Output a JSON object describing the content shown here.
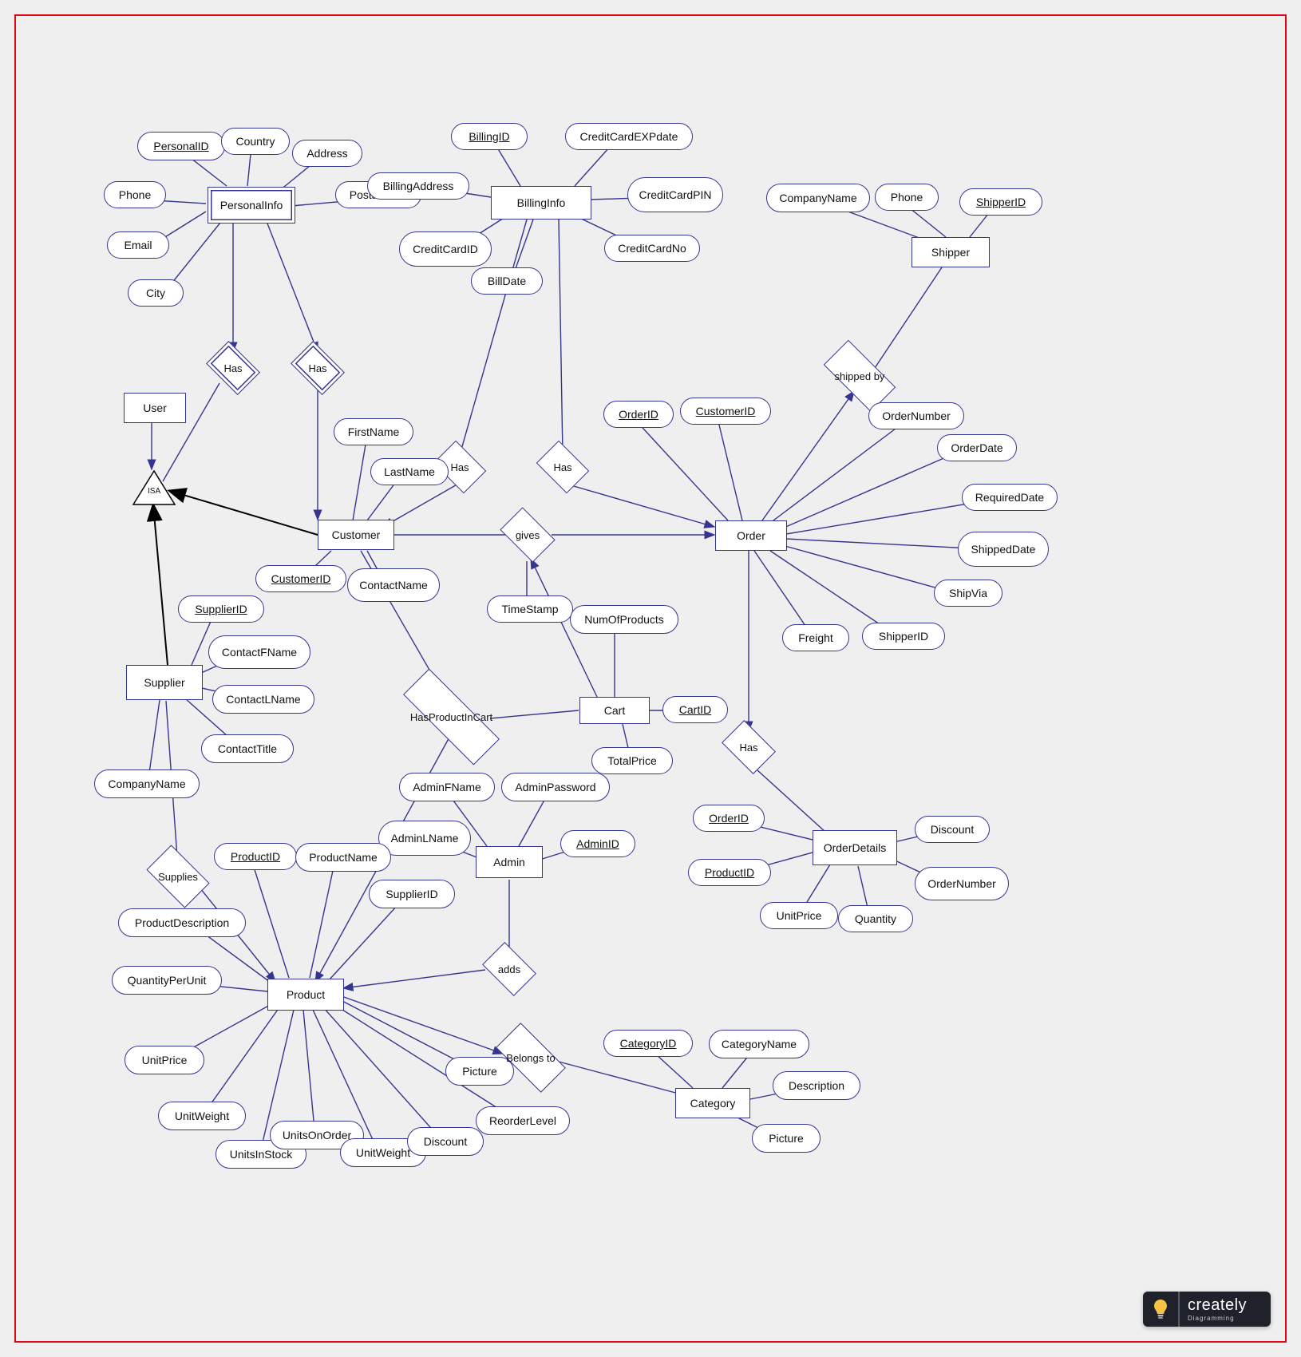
{
  "badge": {
    "title": "creately",
    "subtitle": "Diagramming"
  },
  "entities": {
    "personalInfo": "PersonalInfo",
    "user": "User",
    "billingInfo": "BillingInfo",
    "shipper": "Shipper",
    "customer": "Customer",
    "order": "Order",
    "supplier": "Supplier",
    "cart": "Cart",
    "admin": "Admin",
    "orderDetails": "OrderDetails",
    "product": "Product",
    "category": "Category"
  },
  "relationships": {
    "has1": "Has",
    "has2": "Has",
    "hasBillingC": "Has",
    "hasBillingO": "Has",
    "shippedBy": "shipped by",
    "gives": "gives",
    "hasProductInCart": "HasProductInCart",
    "orderHasDetails": "Has",
    "supplies": "Supplies",
    "adds": "adds",
    "belongsTo": "Belongs to"
  },
  "isa": "ISA",
  "attributes": {
    "personalInfo": {
      "personalID": "PersonalID",
      "country": "Country",
      "address": "Address",
      "postalCode": "PostalCode",
      "phone": "Phone",
      "email": "Email",
      "city": "City"
    },
    "billingInfo": {
      "billingID": "BillingID",
      "creditCardEXPdate": "CreditCardEXPdate",
      "billingAddress": "BillingAddress",
      "creditCardPIN": "CreditCardPIN",
      "creditCardID": "CreditCardID",
      "creditCardNo": "CreditCardNo",
      "billDate": "BillDate"
    },
    "shipper": {
      "companyName": "CompanyName",
      "phone": "Phone",
      "shipperID": "ShipperID"
    },
    "customer": {
      "firstName": "FirstName",
      "lastName": "LastName",
      "customerID": "CustomerID",
      "contactName": "ContactName"
    },
    "gives": {
      "timeStamp": "TimeStamp"
    },
    "cart": {
      "numOfProducts": "NumOfProducts",
      "cartID": "CartID",
      "totalPrice": "TotalPrice"
    },
    "order": {
      "orderID": "OrderID",
      "customerID": "CustomerID",
      "orderNumber": "OrderNumber",
      "orderDate": "OrderDate",
      "requiredDate": "RequiredDate",
      "shippedDate": "ShippedDate",
      "shipVia": "ShipVia",
      "shipperID": "ShipperID",
      "freight": "Freight"
    },
    "supplier": {
      "supplierID": "SupplierID",
      "contactFName": "ContactFName",
      "contactLName": "ContactLName",
      "contactTitle": "ContactTitle",
      "companyName": "CompanyName"
    },
    "admin": {
      "adminFName": "AdminFName",
      "adminPassword": "AdminPassword",
      "adminLName": "AdminLName",
      "adminID": "AdminID"
    },
    "orderDetails": {
      "orderID": "OrderID",
      "productID": "ProductID",
      "discount": "Discount",
      "orderNumber": "OrderNumber",
      "unitPrice": "UnitPrice",
      "quantity": "Quantity"
    },
    "product": {
      "productID": "ProductID",
      "productName": "ProductName",
      "supplierID": "SupplierID",
      "productDescription": "ProductDescription",
      "quantityPerUnit": "QuantityPerUnit",
      "unitPrice": "UnitPrice",
      "unitWeight": "UnitWeight",
      "unitsInStock": "UnitsInStock",
      "unitsOnOrder": "UnitsOnOrder",
      "unitWeight2": "UnitWeight",
      "discount": "Discount",
      "reorderLevel": "ReorderLevel",
      "picture": "Picture"
    },
    "category": {
      "categoryID": "CategoryID",
      "categoryName": "CategoryName",
      "description": "Description",
      "picture": "Picture"
    }
  }
}
